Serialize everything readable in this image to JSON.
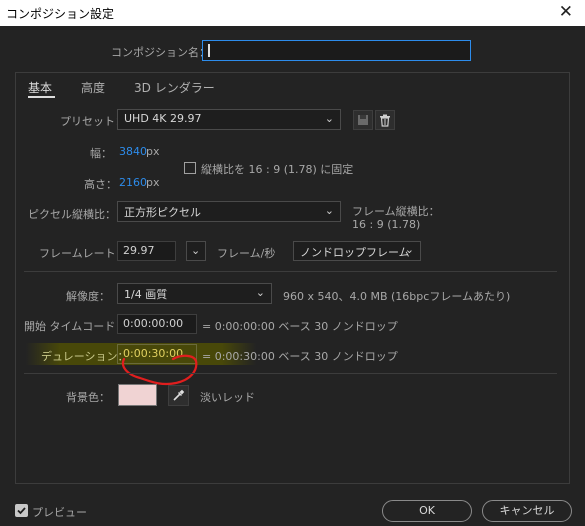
{
  "window": {
    "title": "コンポジション設定",
    "close_glyph": "✕"
  },
  "comp_name": {
    "label": "コンポジション名：",
    "value": ""
  },
  "tabs": [
    {
      "label": "基本"
    },
    {
      "label": "高度"
    },
    {
      "label": "3D レンダラー"
    }
  ],
  "preset": {
    "label": "プリセット：",
    "value": "UHD 4K 29.97"
  },
  "width": {
    "label": "幅：",
    "value": "3840",
    "unit": "px"
  },
  "height": {
    "label": "高さ：",
    "value": "2160",
    "unit": "px"
  },
  "lock_aspect": {
    "label": "縦横比を 16 : 9 (1.78) に固定",
    "checked": false
  },
  "pixel_aspect": {
    "label": "ピクセル縦横比：",
    "value": "正方形ピクセル"
  },
  "frame_aspect": {
    "label": "フレーム縦横比：",
    "value": "16 : 9 (1.78)"
  },
  "frame_rate": {
    "label": "フレームレート：",
    "value": "29.97",
    "unit": "フレーム/秒",
    "drop_frame": "ノンドロップフレーム"
  },
  "resolution": {
    "label": "解像度：",
    "value": "1/4 画質",
    "info": "960 x 540、4.0 MB (16bpcフレームあたり)"
  },
  "start_timecode": {
    "label": "開始 タイムコード：",
    "value": "0:00:00:00",
    "info": "= 0:00:00:00  ベース 30  ノンドロップ"
  },
  "duration": {
    "label": "デュレーション：",
    "value": "0:00:30:00",
    "info": "= 0:00:30:00  ベース 30  ノンドロップ"
  },
  "background": {
    "label": "背景色：",
    "color_name": "淡いレッド",
    "swatch": "#f0d3d3"
  },
  "preview": {
    "label": "プレビュー",
    "checked": true
  },
  "buttons": {
    "ok": "OK",
    "cancel": "キャンセル"
  },
  "colors": {
    "accent_blue": "#2d8ceb",
    "highlight": "#555500",
    "annotation_red": "#e01e1e"
  },
  "icons": [
    "close-icon",
    "chevron-down-icon",
    "save-preset-icon",
    "trash-icon",
    "eyedropper-icon",
    "checkbox-checked-icon"
  ]
}
